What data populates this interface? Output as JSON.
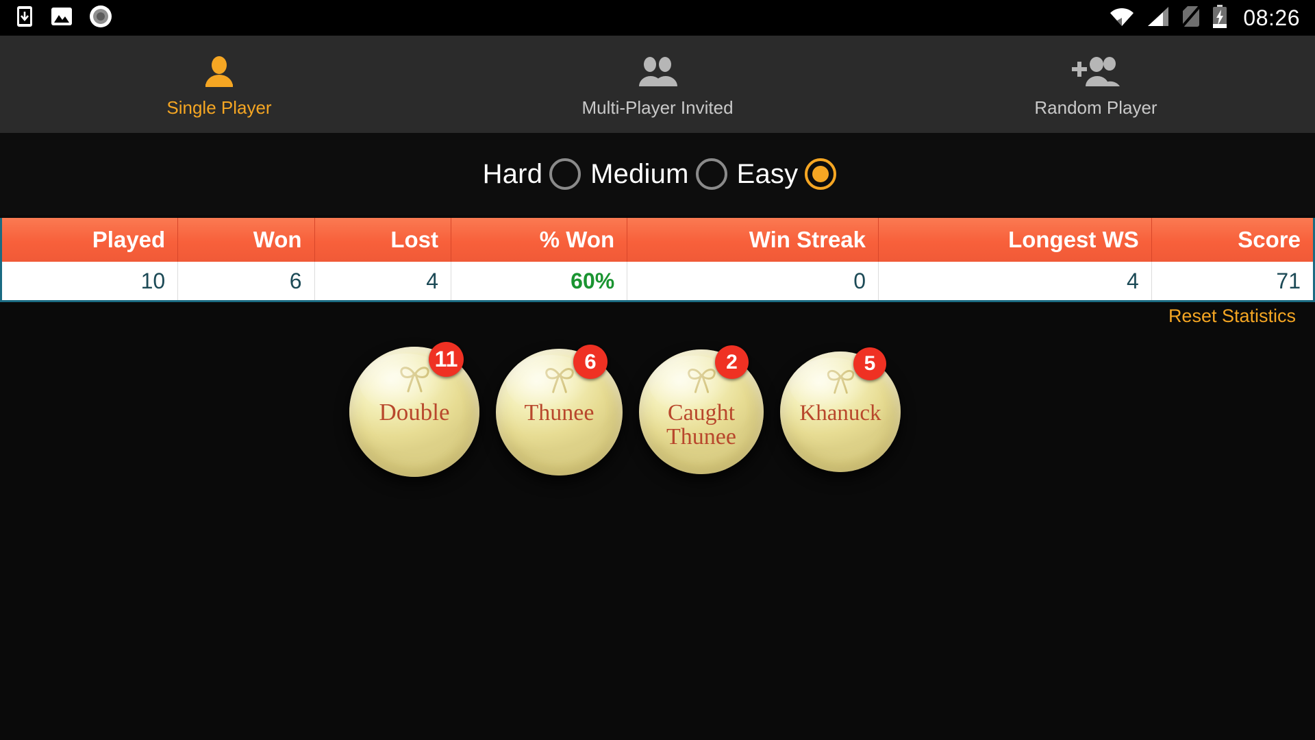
{
  "statusbar": {
    "time": "08:26",
    "left_icons": [
      "install-app-icon",
      "image-icon",
      "record-circle-icon"
    ],
    "right_icons": [
      "wifi-icon",
      "cellular-signal-icon",
      "no-sim-icon",
      "battery-charging-icon"
    ]
  },
  "tabs": [
    {
      "label": "Single Player",
      "icon": "single-person-icon",
      "active": true
    },
    {
      "label": "Multi-Player Invited",
      "icon": "two-people-icon",
      "active": false
    },
    {
      "label": "Random Player",
      "icon": "person-add-icon",
      "active": false
    }
  ],
  "difficulty": {
    "options": [
      {
        "label": "Hard",
        "selected": false
      },
      {
        "label": "Medium",
        "selected": false
      },
      {
        "label": "Easy",
        "selected": true
      }
    ],
    "selected": "Easy"
  },
  "reset_statistics_label": "Reset Statistics",
  "stats": {
    "columns": [
      "Played",
      "Won",
      "Lost",
      "% Won",
      "Win Streak",
      "Longest WS",
      "Score"
    ],
    "values": [
      "10",
      "6",
      "4",
      "60%",
      "0",
      "4",
      "71"
    ],
    "percent_column_index": 3
  },
  "badges": [
    {
      "label": "Double",
      "count": "11",
      "size": 190
    },
    {
      "label": "Thunee",
      "count": "6",
      "size": 185
    },
    {
      "label": "Caught Thunee",
      "count": "2",
      "size": 182
    },
    {
      "label": "Khanuck",
      "count": "5",
      "size": 176
    }
  ],
  "colors": {
    "accent_orange": "#f5a623",
    "table_header": "#f8603b",
    "table_border": "#1b6b82",
    "percent_green": "#1a9431",
    "badge_red": "#ef3123",
    "medal_text": "#b8472c",
    "tabbar_bg": "#2b2b2b",
    "page_bg": "#0a0a0a"
  }
}
